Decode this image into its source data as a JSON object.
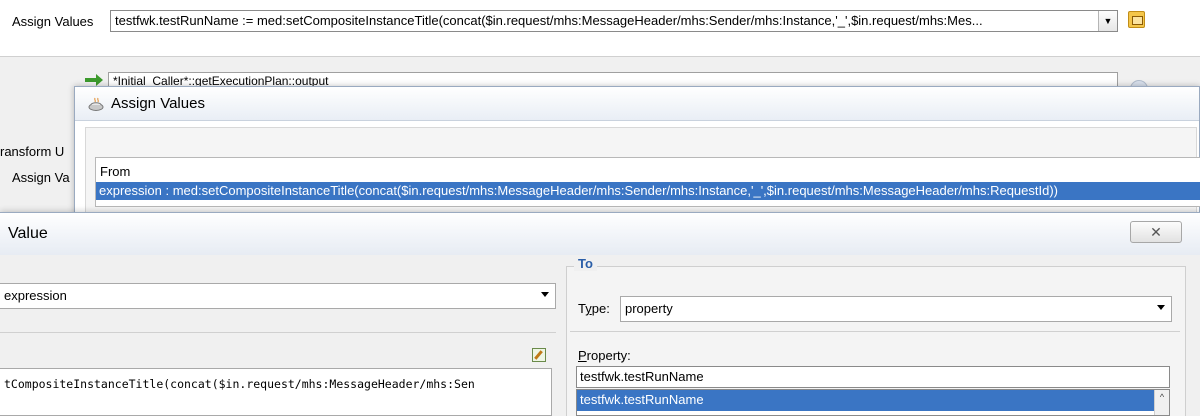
{
  "background_window": {
    "assign_label": "Assign Values",
    "assign_combo_value": "testfwk.testRunName := med:setCompositeInstanceTitle(concat($in.request/mhs:MessageHeader/mhs:Sender/mhs:Instance,'_',$in.request/mhs:Mes...",
    "field2_value": "*Initial_Caller*::getExecutionPlan::output",
    "left_label_transform": "ransform U",
    "left_label_assign": "Assign Va"
  },
  "assign_dialog": {
    "title": "Assign Values",
    "list_header": "From",
    "list_row": "expression : med:setCompositeInstanceTitle(concat($in.request/mhs:MessageHeader/mhs:Sender/mhs:Instance,'_',$in.request/mhs:MessageHeader/mhs:RequestId))"
  },
  "value_dialog": {
    "title": "Value",
    "close_glyph": "✕",
    "from": {
      "type_value": "expression",
      "expression_text": "tCompositeInstanceTitle(concat($in.request/mhs:MessageHeader/mhs:Sen"
    },
    "to": {
      "legend": "To",
      "type_label_prefix": "T",
      "type_label_underlined": "y",
      "type_label_suffix": "pe:",
      "type_value": "property",
      "property_label_underlined": "P",
      "property_label_suffix": "roperty:",
      "property_value": "testfwk.testRunName",
      "suggestion": "testfwk.testRunName",
      "scroll_up_glyph": "^"
    }
  },
  "colors": {
    "selection": "#3a75c4",
    "to_legend": "#2a5ea8"
  }
}
